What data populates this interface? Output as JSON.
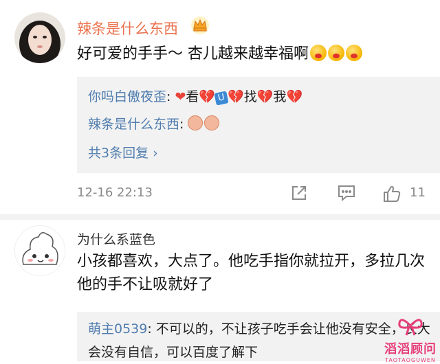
{
  "comment1": {
    "username": "辣条是什么东西",
    "text": "好可爱的手手～ 杏儿越来越幸福啊",
    "replies": [
      {
        "name": "你吗白傲夜歪",
        "sep": ": ",
        "t1": "看",
        "t2": "找",
        "t3": "我"
      },
      {
        "name": "辣条是什么东西",
        "sep": ": "
      }
    ],
    "more": "共3条回复 ›",
    "date": "12-16 22:13",
    "likes": "11"
  },
  "comment2": {
    "username": "为什么系蓝色",
    "text": "小孩都喜欢，大点了。他吃手指你就拉开，多拉几次他的手不让吸就好了",
    "reply": {
      "name": "萌主0539",
      "text": ": 不可以的，不让孩子吃手会让他没有安全，长大会没有自信，可以百度了解下"
    }
  },
  "watermark": {
    "title": "滔滔顾问",
    "sub": "TAOTAOGUWEN"
  },
  "colors": {
    "username": "#eb7350",
    "link": "#507daf",
    "reply_bg": "#f2f2f2"
  }
}
